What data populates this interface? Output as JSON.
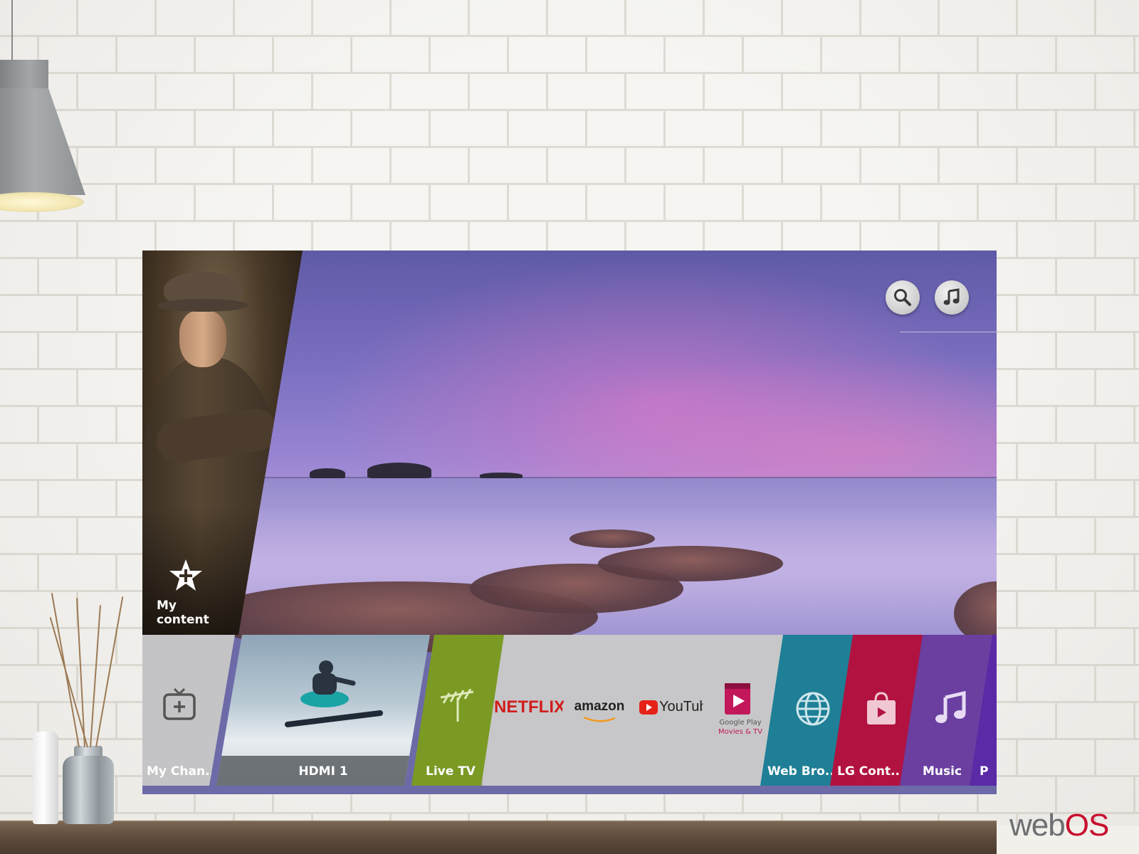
{
  "brand": {
    "logo_text": "webOS",
    "logo_color_web": "#6d6f71",
    "logo_color_os": "#c8102e"
  },
  "tv": {
    "top_buttons": [
      {
        "name": "search-icon"
      },
      {
        "name": "music-icon"
      }
    ],
    "my_content": {
      "label": "My content"
    },
    "launcher": {
      "items": [
        {
          "label": "My Chan..",
          "color": "#c4c4c6",
          "icon": "add-channel-icon"
        },
        {
          "label": "HDMI 1",
          "color": "#6f7e8a",
          "icon": "hdmi-thumbnail"
        },
        {
          "label": "Live TV",
          "color": "#7a9a24",
          "icon": "antenna-icon"
        },
        {
          "label": "NETFLIX",
          "color": "#c7c7c9",
          "icon": "netflix-logo"
        },
        {
          "label": "amazon",
          "color": "#c7c7c9",
          "icon": "amazon-logo"
        },
        {
          "label": "YouTube",
          "color": "#c7c7c9",
          "icon": "youtube-logo"
        },
        {
          "label": "Google Play",
          "sublabel": "Movies & TV",
          "color": "#c7c7c9",
          "icon": "google-play-movies-icon"
        },
        {
          "label": "Web Bro..",
          "color": "#1e7f96",
          "icon": "globe-icon"
        },
        {
          "label": "LG Cont..",
          "color": "#b2123f",
          "icon": "lg-content-store-icon"
        },
        {
          "label": "Music",
          "color": "#6a3fa0",
          "icon": "music-note-icon"
        },
        {
          "label": "P",
          "color": "#5b2aa6",
          "icon": "partial-tile"
        }
      ]
    }
  }
}
